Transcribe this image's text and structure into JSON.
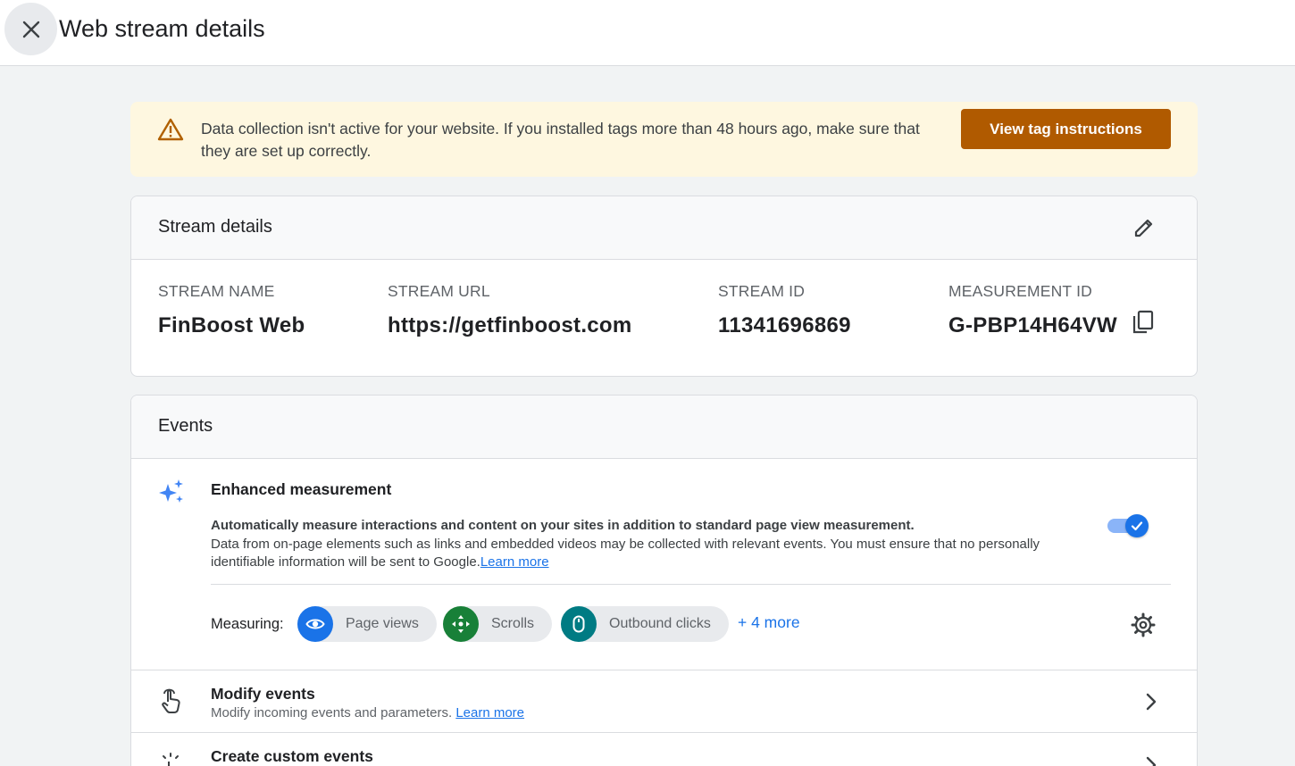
{
  "header": {
    "title": "Web stream details"
  },
  "banner": {
    "message": "Data collection isn't active for your website. If you installed tags more than 48 hours ago, make sure that they are set up correctly.",
    "button_label": "View tag instructions"
  },
  "stream_details": {
    "title": "Stream details",
    "fields": [
      {
        "label": "STREAM NAME",
        "value": "FinBoost Web"
      },
      {
        "label": "STREAM URL",
        "value": "https://getfinboost.com"
      },
      {
        "label": "STREAM ID",
        "value": "11341696869"
      },
      {
        "label": "MEASUREMENT ID",
        "value": "G-PBP14H64VW"
      }
    ]
  },
  "events": {
    "title": "Events",
    "enhanced": {
      "title": "Enhanced measurement",
      "description_bold": "Automatically measure interactions and content on your sites in addition to standard page view measurement.",
      "description": "Data from on-page elements such as links and embedded videos may be collected with relevant events. You must ensure that no personally identifiable information will be sent to Google.",
      "learn_more": "Learn more",
      "toggle_on": true
    },
    "measuring": {
      "label": "Measuring:",
      "chips": [
        {
          "label": "Page views",
          "icon": "eye-icon",
          "color": "#1a73e8"
        },
        {
          "label": "Scrolls",
          "icon": "scroll-arrows-icon",
          "color": "#188038"
        },
        {
          "label": "Outbound clicks",
          "icon": "mouse-icon",
          "color": "#007b83"
        }
      ],
      "more": "+ 4 more"
    },
    "modify": {
      "title": "Modify events",
      "description": "Modify incoming events and parameters.",
      "learn_more": "Learn more"
    },
    "create": {
      "title": "Create custom events"
    }
  },
  "colors": {
    "accent": "#1a73e8",
    "warning_button": "#b05a00",
    "banner_bg": "#fef7e0"
  }
}
